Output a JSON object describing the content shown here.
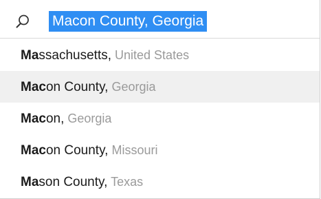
{
  "search": {
    "icon": "search-icon",
    "value": "Macon County, Georgia"
  },
  "suggestions": [
    {
      "match": "Ma",
      "rest": "ssachusetts,",
      "context": " United States",
      "highlighted": false
    },
    {
      "match": "Mac",
      "rest": "on County,",
      "context": " Georgia",
      "highlighted": true
    },
    {
      "match": "Mac",
      "rest": "on,",
      "context": " Georgia",
      "highlighted": false
    },
    {
      "match": "Mac",
      "rest": "on County,",
      "context": " Missouri",
      "highlighted": false
    },
    {
      "match": "Ma",
      "rest": "son County,",
      "context": " Texas",
      "highlighted": false
    }
  ],
  "colors": {
    "selection": "#2f8ef3",
    "highlight_row": "#f0f0f0",
    "context_text": "#9a9a9a"
  }
}
